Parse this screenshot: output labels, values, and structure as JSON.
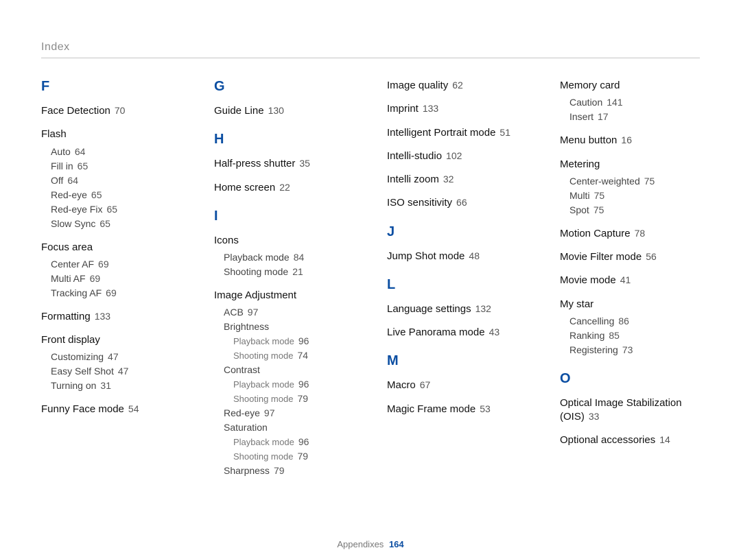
{
  "title": "Index",
  "footer": {
    "label": "Appendixes",
    "page": "164"
  },
  "columns": [
    {
      "groups": [
        {
          "letter": "F",
          "entries": [
            {
              "label": "Face Detection",
              "page": "70"
            },
            {
              "label": "Flash",
              "sub": [
                {
                  "label": "Auto",
                  "page": "64"
                },
                {
                  "label": "Fill in",
                  "page": "65"
                },
                {
                  "label": "Off",
                  "page": "64"
                },
                {
                  "label": "Red-eye",
                  "page": "65"
                },
                {
                  "label": "Red-eye Fix",
                  "page": "65"
                },
                {
                  "label": "Slow Sync",
                  "page": "65"
                }
              ]
            },
            {
              "label": "Focus area",
              "sub": [
                {
                  "label": "Center AF",
                  "page": "69"
                },
                {
                  "label": "Multi AF",
                  "page": "69"
                },
                {
                  "label": "Tracking AF",
                  "page": "69"
                }
              ]
            },
            {
              "label": "Formatting",
              "page": "133"
            },
            {
              "label": "Front display",
              "sub": [
                {
                  "label": "Customizing",
                  "page": "47"
                },
                {
                  "label": "Easy Self Shot",
                  "page": "47"
                },
                {
                  "label": "Turning on",
                  "page": "31"
                }
              ]
            },
            {
              "label": "Funny Face mode",
              "page": "54"
            }
          ]
        }
      ]
    },
    {
      "groups": [
        {
          "letter": "G",
          "entries": [
            {
              "label": "Guide Line",
              "page": "130"
            }
          ]
        },
        {
          "letter": "H",
          "entries": [
            {
              "label": "Half-press shutter",
              "page": "35"
            },
            {
              "label": "Home screen",
              "page": "22"
            }
          ]
        },
        {
          "letter": "I",
          "entries": [
            {
              "label": "Icons",
              "sub": [
                {
                  "label": "Playback mode",
                  "page": "84"
                },
                {
                  "label": "Shooting mode",
                  "page": "21"
                }
              ]
            },
            {
              "label": "Image Adjustment",
              "sub": [
                {
                  "label": "ACB",
                  "page": "97"
                },
                {
                  "label": "Brightness",
                  "sub": [
                    {
                      "label": "Playback mode",
                      "page": "96"
                    },
                    {
                      "label": "Shooting mode",
                      "page": "74"
                    }
                  ]
                },
                {
                  "label": "Contrast",
                  "sub": [
                    {
                      "label": "Playback mode",
                      "page": "96"
                    },
                    {
                      "label": "Shooting mode",
                      "page": "79"
                    }
                  ]
                },
                {
                  "label": "Red-eye",
                  "page": "97"
                },
                {
                  "label": "Saturation",
                  "sub": [
                    {
                      "label": "Playback mode",
                      "page": "96"
                    },
                    {
                      "label": "Shooting mode",
                      "page": "79"
                    }
                  ]
                },
                {
                  "label": "Sharpness",
                  "page": "79"
                }
              ]
            }
          ]
        }
      ]
    },
    {
      "groups": [
        {
          "letter": "",
          "entries": [
            {
              "label": "Image quality",
              "page": "62"
            },
            {
              "label": "Imprint",
              "page": "133"
            },
            {
              "label": "Intelligent Portrait mode",
              "page": "51"
            },
            {
              "label": "Intelli-studio",
              "page": "102"
            },
            {
              "label": "Intelli zoom",
              "page": "32"
            },
            {
              "label": "ISO sensitivity",
              "page": "66"
            }
          ]
        },
        {
          "letter": "J",
          "entries": [
            {
              "label": "Jump Shot mode",
              "page": "48"
            }
          ]
        },
        {
          "letter": "L",
          "entries": [
            {
              "label": "Language settings",
              "page": "132"
            },
            {
              "label": "Live Panorama mode",
              "page": "43"
            }
          ]
        },
        {
          "letter": "M",
          "entries": [
            {
              "label": "Macro",
              "page": "67"
            },
            {
              "label": "Magic Frame mode",
              "page": "53"
            }
          ]
        }
      ]
    },
    {
      "groups": [
        {
          "letter": "",
          "entries": [
            {
              "label": "Memory card",
              "sub": [
                {
                  "label": "Caution",
                  "page": "141"
                },
                {
                  "label": "Insert",
                  "page": "17"
                }
              ]
            },
            {
              "label": "Menu button",
              "page": "16"
            },
            {
              "label": "Metering",
              "sub": [
                {
                  "label": "Center-weighted",
                  "page": "75"
                },
                {
                  "label": "Multi",
                  "page": "75"
                },
                {
                  "label": "Spot",
                  "page": "75"
                }
              ]
            },
            {
              "label": "Motion Capture",
              "page": "78"
            },
            {
              "label": "Movie Filter mode",
              "page": "56"
            },
            {
              "label": "Movie mode",
              "page": "41"
            },
            {
              "label": "My star",
              "sub": [
                {
                  "label": "Cancelling",
                  "page": "86"
                },
                {
                  "label": "Ranking",
                  "page": "85"
                },
                {
                  "label": "Registering",
                  "page": "73"
                }
              ]
            }
          ]
        },
        {
          "letter": "O",
          "entries": [
            {
              "label": "Optical Image Stabilization (OIS)",
              "page": "33"
            },
            {
              "label": "Optional accessories",
              "page": "14"
            }
          ]
        }
      ]
    }
  ]
}
